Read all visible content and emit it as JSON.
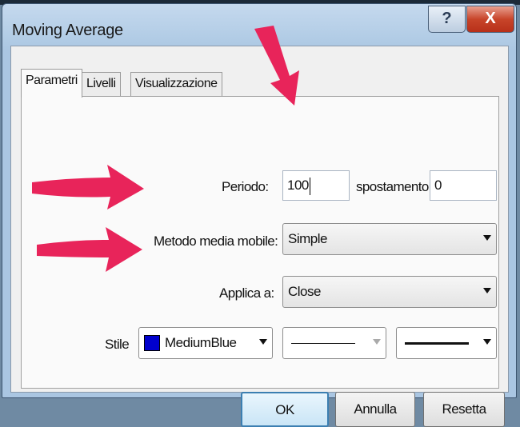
{
  "window": {
    "title": "Moving Average",
    "help_label": "?",
    "close_label": "X"
  },
  "tabs": [
    {
      "label": "Parametri",
      "active": true
    },
    {
      "label": "Livelli",
      "active": false
    },
    {
      "label": "Visualizzazione",
      "active": false
    }
  ],
  "params": {
    "period_label": "Periodo:",
    "period_value": "100",
    "shift_label": "spostamento",
    "shift_value": "0",
    "method_label": "Metodo media mobile:",
    "method_value": "Simple",
    "apply_label": "Applica a:",
    "apply_value": "Close",
    "style_label": "Stile",
    "color_value": "MediumBlue",
    "color_hex": "#0000CD"
  },
  "buttons": {
    "ok": "OK",
    "cancel": "Annulla",
    "reset": "Resetta"
  },
  "annotations": {
    "arrow_color": "#E8245A",
    "arrows": [
      "pointing-down-to-period",
      "pointing-right-to-method",
      "pointing-right-to-apply"
    ]
  }
}
